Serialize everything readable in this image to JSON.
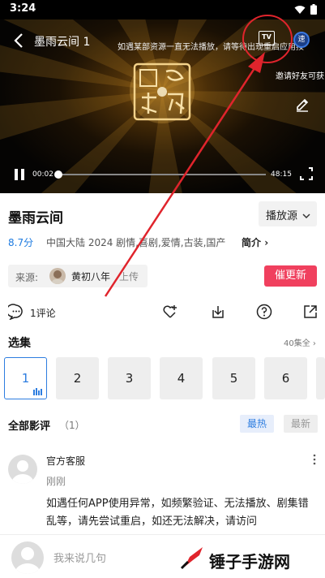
{
  "status_bar": {
    "time": "3:24"
  },
  "player": {
    "title": "墨雨云间 1",
    "notice": "如遇某部资源一直无法播放，请等待出现重启应用按",
    "tv_label": "TV",
    "speed_label": "速",
    "invite": "邀请好友可获",
    "logo_text": "网飞猫",
    "current_time": "00:02",
    "total_time": "48:15",
    "progress": 0.01
  },
  "info": {
    "title": "墨雨云间",
    "source_button": "播放源",
    "rating": "8.7分",
    "meta": "中国大陆  2024  剧情,喜剧,爱情,古装,国产",
    "intro_link": "简介"
  },
  "uploader": {
    "label": "来源:",
    "name": "黄初八年",
    "suffix": "上传"
  },
  "urge_button": "催更新",
  "actions": {
    "comment_count": "1评论"
  },
  "episodes": {
    "label": "选集",
    "total": "40集全",
    "items": [
      "1",
      "2",
      "3",
      "4",
      "5",
      "6"
    ]
  },
  "reviews": {
    "label": "全部影评",
    "count": "（1）",
    "sort_hot": "最热",
    "sort_new": "最新"
  },
  "comment": {
    "author": "官方客服",
    "time": "刚刚",
    "body": "如遇任何APP使用异常，如频繁验证、无法播放、剧集错乱等，请先尝试重启，如还无法解决，请访问"
  },
  "input": {
    "placeholder": "我来说几句"
  },
  "watermark": {
    "text": "锤子手游网"
  },
  "colors": {
    "accent_blue": "#2d7de0",
    "urge_red": "#f0405e",
    "annotation_red": "#e0242c"
  }
}
